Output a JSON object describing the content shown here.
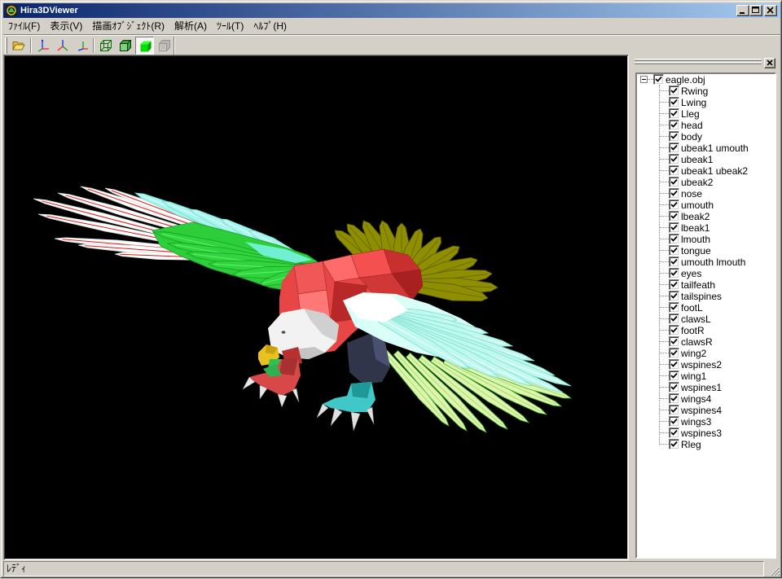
{
  "window": {
    "title": "Hira3DViewer",
    "app_icon": "hira3d-app-icon",
    "controls": [
      "minimize-icon",
      "maximize-icon",
      "close-icon"
    ]
  },
  "menu": [
    {
      "label": "ﾌｧｲﾙ(F)"
    },
    {
      "label": "表示(V)"
    },
    {
      "label": "描画ｵﾌﾞｼﾞｪｸﾄ(R)"
    },
    {
      "label": "解析(A)"
    },
    {
      "label": "ﾂｰﾙ(T)"
    },
    {
      "label": "ﾍﾙﾌﾟ(H)"
    }
  ],
  "toolbar": {
    "buttons": [
      {
        "icon": "open-folder-icon",
        "pressed": false,
        "disabled": false
      },
      {
        "icon": "axes-front-view-icon",
        "pressed": false,
        "disabled": false
      },
      {
        "icon": "axes-side-view-icon",
        "pressed": false,
        "disabled": false
      },
      {
        "icon": "axes-top-view-icon",
        "pressed": false,
        "disabled": false
      },
      {
        "icon": "wireframe-cube-icon",
        "pressed": false,
        "disabled": false
      },
      {
        "icon": "edged-cube-icon",
        "pressed": false,
        "disabled": false
      },
      {
        "icon": "solid-cube-icon",
        "pressed": true,
        "disabled": false
      },
      {
        "icon": "textured-cube-icon",
        "pressed": false,
        "disabled": true
      }
    ]
  },
  "object_panel": {
    "close_icon": "close-icon",
    "tree": {
      "root": {
        "label": "eagle.obj",
        "checked": true,
        "expanded": true
      },
      "children": [
        {
          "label": "Rwing",
          "checked": true
        },
        {
          "label": "Lwing",
          "checked": true
        },
        {
          "label": "Lleg",
          "checked": true
        },
        {
          "label": "head",
          "checked": true
        },
        {
          "label": "body",
          "checked": true
        },
        {
          "label": "ubeak1 umouth",
          "checked": true
        },
        {
          "label": "ubeak1",
          "checked": true
        },
        {
          "label": "ubeak1 ubeak2",
          "checked": true
        },
        {
          "label": "ubeak2",
          "checked": true
        },
        {
          "label": "nose",
          "checked": true
        },
        {
          "label": "umouth",
          "checked": true
        },
        {
          "label": "lbeak2",
          "checked": true
        },
        {
          "label": "lbeak1",
          "checked": true
        },
        {
          "label": "lmouth",
          "checked": true
        },
        {
          "label": "tongue",
          "checked": true
        },
        {
          "label": "umouth lmouth",
          "checked": true
        },
        {
          "label": "eyes",
          "checked": true
        },
        {
          "label": "tailfeath",
          "checked": true
        },
        {
          "label": "tailspines",
          "checked": true
        },
        {
          "label": "footL",
          "checked": true
        },
        {
          "label": "clawsL",
          "checked": true
        },
        {
          "label": "footR",
          "checked": true
        },
        {
          "label": "clawsR",
          "checked": true
        },
        {
          "label": "wing2",
          "checked": true
        },
        {
          "label": "wspines2",
          "checked": true
        },
        {
          "label": "wing1",
          "checked": true
        },
        {
          "label": "wspines1",
          "checked": true
        },
        {
          "label": "wings4",
          "checked": true
        },
        {
          "label": "wspines4",
          "checked": true
        },
        {
          "label": "wings3",
          "checked": true
        },
        {
          "label": "wspines3",
          "checked": true
        },
        {
          "label": "Rleg",
          "checked": true
        }
      ]
    }
  },
  "status_bar": {
    "text": "ﾚﾃﾞｨ"
  },
  "colors": {
    "title_gradient_start": "#0a246a",
    "title_gradient_end": "#a6caf0",
    "face": "#d4d0c8",
    "viewport_background": "#000000"
  }
}
